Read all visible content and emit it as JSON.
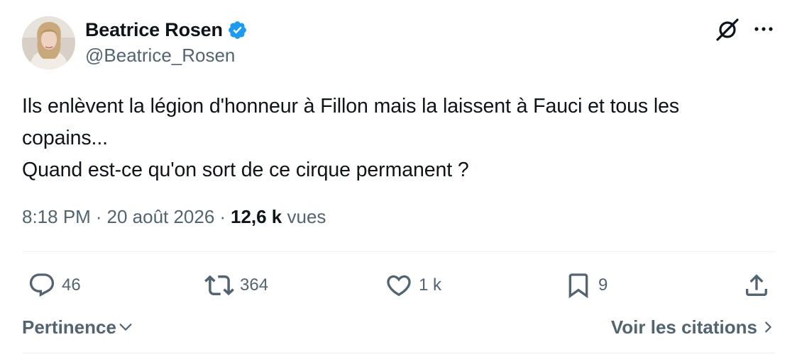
{
  "author": {
    "display_name": "Beatrice Rosen",
    "handle": "@Beatrice_Rosen",
    "verified": true,
    "avatar_icon": "profile-photo"
  },
  "header_icons": {
    "grok": "grok-icon",
    "more": "more-options-icon"
  },
  "tweet": {
    "lines": [
      "Ils enlèvent la légion d'honneur à Fillon mais la laissent à Fauci et tous les",
      "copains...",
      "Quand est-ce qu'on sort de ce cirque permanent ?"
    ]
  },
  "meta": {
    "time": "8:18 PM",
    "separator": "·",
    "date": "20 août 2026",
    "views_count": "12,6 k",
    "views_label": "vues"
  },
  "actions": {
    "replies": "46",
    "reposts": "364",
    "likes": "1 k",
    "bookmarks": "9"
  },
  "replies_bar": {
    "sort_label": "Pertinence",
    "quotes_label": "Voir les citations"
  },
  "colors": {
    "text_primary": "#0f1419",
    "text_secondary": "#536471",
    "verified_blue": "#1d9bf0",
    "divider": "#eff3f4"
  }
}
